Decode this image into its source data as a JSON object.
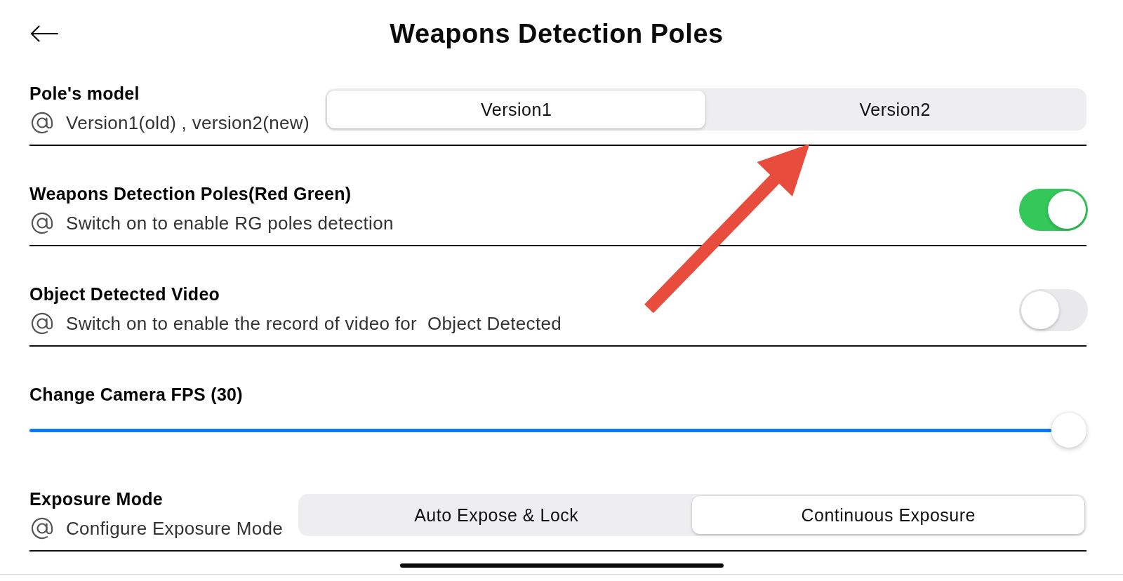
{
  "header": {
    "title": "Weapons Detection Poles"
  },
  "settings": [
    {
      "kind": "segmented",
      "label": "Pole's model",
      "description": "Version1(old) , version2(new)",
      "options": [
        {
          "label": "Version1",
          "selected": true
        },
        {
          "label": "Version2",
          "selected": false
        }
      ]
    },
    {
      "kind": "toggle",
      "label": "Weapons Detection Poles(Red Green)",
      "description": "Switch on to enable RG poles detection",
      "on": true
    },
    {
      "kind": "toggle",
      "label": "Object Detected Video",
      "description": "Switch on to enable the record of video for  Object Detected",
      "on": false
    },
    {
      "kind": "slider",
      "label": "Change Camera FPS (30)",
      "level": 1.0
    },
    {
      "kind": "segmented",
      "label": "Exposure Mode",
      "description": "Configure Exposure Mode",
      "options": [
        {
          "label": "Auto Expose & Lock",
          "selected": false
        },
        {
          "label": "Continuous Exposure",
          "selected": true
        }
      ]
    }
  ]
}
